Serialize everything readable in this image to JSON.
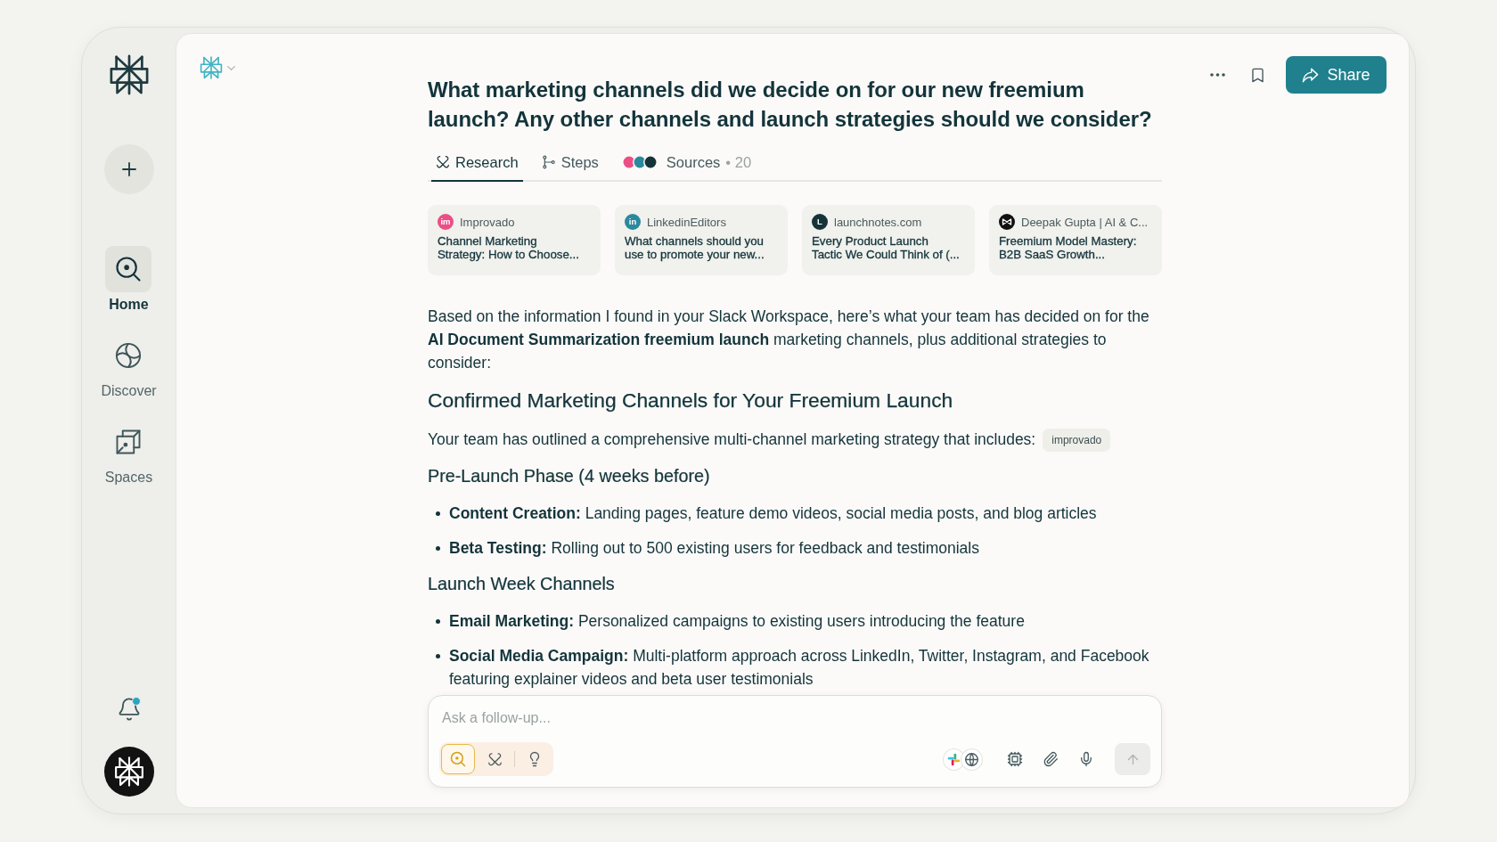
{
  "sidebar": {
    "nav": [
      {
        "kind": "home",
        "label": "Home",
        "selected": true
      },
      {
        "kind": "discover",
        "label": "Discover",
        "selected": false
      },
      {
        "kind": "spaces",
        "label": "Spaces",
        "selected": false
      }
    ],
    "notifications": {
      "unread": true
    }
  },
  "header": {
    "share": "Share"
  },
  "thread": {
    "title": "What marketing channels did we decide on for our new freemium launch? Any other channels and launch strategies should we consider?",
    "tabs": [
      {
        "kind": "research",
        "label": "Research",
        "selected": true
      },
      {
        "kind": "steps",
        "label": "Steps",
        "selected": false
      },
      {
        "kind": "sources",
        "label": "Sources",
        "count": "• 20",
        "selected": false
      }
    ],
    "sources": [
      {
        "site": "Improvado",
        "title": "Channel Marketing\nStrategy: How to Choose...",
        "logo": {
          "kind": "monogram",
          "text": "im",
          "color": "#ec4e86"
        }
      },
      {
        "site": "LinkedinEditors",
        "title": "What channels should you\nuse to promote your new...",
        "logo": {
          "kind": "monogram",
          "text": "in",
          "color": "#2a8a9d"
        }
      },
      {
        "site": "launchnotes.com",
        "title": "Every Product Launch\nTactic We Could Think of (...",
        "logo": {
          "kind": "monogram",
          "text": "L",
          "color": "#17333a"
        }
      },
      {
        "site": "Deepak Gupta | AI & C...",
        "title": "Freemium Model Mastery:\nB2B SaaS Growth...",
        "logo": {
          "kind": "symbol",
          "color": "#111111"
        }
      }
    ],
    "answer": [
      {
        "kind": "paragraph",
        "text": "Based on the information I found in your Slack Workspace, here’s what your team has decided on for the **AI Document Summarization freemium launch** marketing channels, plus additional strategies to consider:"
      },
      {
        "kind": "section_heading",
        "text": "Confirmed Marketing Channels for Your Freemium Launch"
      },
      {
        "kind": "paragraph",
        "text": "Your team has outlined a comprehensive multi-channel marketing strategy that includes:",
        "citation": "improvado"
      },
      {
        "kind": "subheading",
        "text": "Pre-Launch Phase (4 weeks before)"
      },
      {
        "kind": "bullets",
        "items": [
          "**Content Creation:** Landing pages, feature demo videos, social media posts, and blog articles",
          "**Beta Testing:** Rolling out to 500 existing users for feedback and testimonials"
        ]
      },
      {
        "kind": "subheading",
        "text": "Launch Week Channels"
      },
      {
        "kind": "bullets",
        "items": [
          "**Email Marketing:** Personalized campaigns to existing users introducing the feature",
          "**Social Media Campaign:** Multi-platform approach across LinkedIn, Twitter, Instagram, and Facebook featuring explainer videos and beta user testimonials"
        ]
      }
    ]
  },
  "composer": {
    "placeholder": "Ask a follow-up...",
    "modes": [
      {
        "kind": "search",
        "selected": true
      },
      {
        "kind": "research",
        "selected": false
      },
      {
        "kind": "labs",
        "selected": false
      }
    ],
    "sources": [
      {
        "kind": "slack",
        "on": true
      },
      {
        "kind": "web",
        "on": true
      }
    ],
    "send_disabled": true
  }
}
